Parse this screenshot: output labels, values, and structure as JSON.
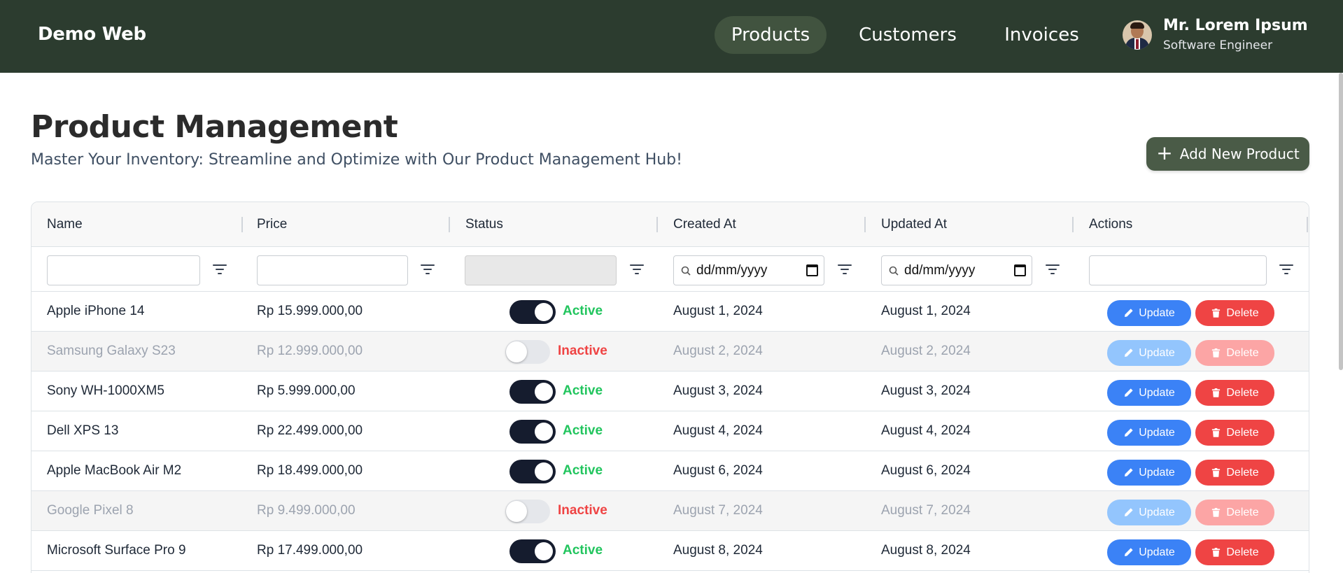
{
  "header": {
    "brand": "Demo Web",
    "nav": [
      {
        "label": "Products",
        "active": true
      },
      {
        "label": "Customers",
        "active": false
      },
      {
        "label": "Invoices",
        "active": false
      }
    ],
    "user": {
      "name": "Mr. Lorem Ipsum",
      "role": "Software Engineer"
    }
  },
  "page": {
    "title": "Product Management",
    "subtitle": "Master Your Inventory: Streamline and Optimize with Our Product Management Hub!",
    "add_button": "Add New Product"
  },
  "table": {
    "columns": [
      "Name",
      "Price",
      "Status",
      "Created At",
      "Updated At",
      "Actions"
    ],
    "filters": {
      "name": "",
      "price": "",
      "created_placeholder": "dd/mm/yyyy",
      "updated_placeholder": "dd/mm/yyyy",
      "actions": ""
    },
    "update_label": "Update",
    "delete_label": "Delete",
    "rows": [
      {
        "name": "Apple iPhone 14",
        "price": "Rp 15.999.000,00",
        "active": true,
        "status": "Active",
        "created": "August 1, 2024",
        "updated": "August 1, 2024"
      },
      {
        "name": "Samsung Galaxy S23",
        "price": "Rp 12.999.000,00",
        "active": false,
        "status": "Inactive",
        "created": "August 2, 2024",
        "updated": "August 2, 2024"
      },
      {
        "name": "Sony WH-1000XM5",
        "price": "Rp 5.999.000,00",
        "active": true,
        "status": "Active",
        "created": "August 3, 2024",
        "updated": "August 3, 2024"
      },
      {
        "name": "Dell XPS 13",
        "price": "Rp 22.499.000,00",
        "active": true,
        "status": "Active",
        "created": "August 4, 2024",
        "updated": "August 4, 2024"
      },
      {
        "name": "Apple MacBook Air M2",
        "price": "Rp 18.499.000,00",
        "active": true,
        "status": "Active",
        "created": "August 6, 2024",
        "updated": "August 6, 2024"
      },
      {
        "name": "Google Pixel 8",
        "price": "Rp 9.499.000,00",
        "active": false,
        "status": "Inactive",
        "created": "August 7, 2024",
        "updated": "August 7, 2024"
      },
      {
        "name": "Microsoft Surface Pro 9",
        "price": "Rp 17.499.000,00",
        "active": true,
        "status": "Active",
        "created": "August 8, 2024",
        "updated": "August 8, 2024"
      }
    ]
  },
  "colors": {
    "header_bg": "#2c3c2f",
    "nav_active_bg": "#41533f",
    "add_button_bg": "#4a5b47",
    "active_green": "#22c55e",
    "inactive_red": "#ef4444",
    "update_blue": "#3b82f6",
    "delete_red": "#ef4444"
  }
}
